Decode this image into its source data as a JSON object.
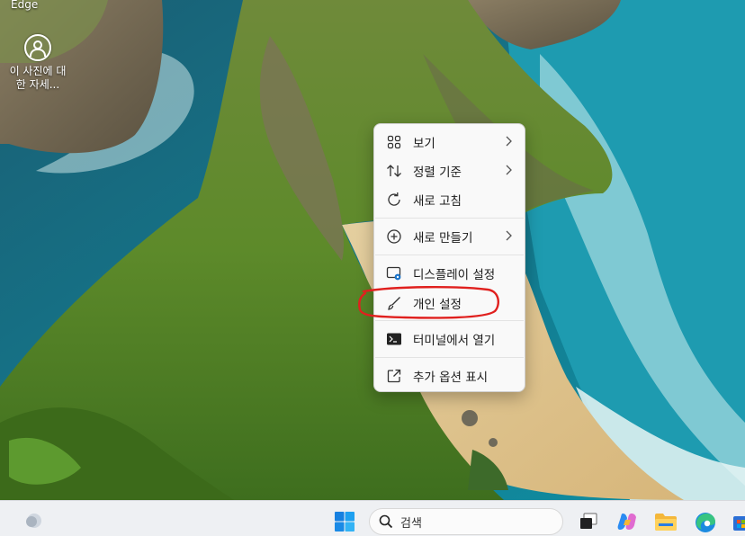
{
  "desktop": {
    "edge_label": "Edge",
    "info_icon_label": "이 사진에 대한 자세..."
  },
  "context_menu": {
    "items": [
      {
        "label": "보기",
        "icon": "grid-icon",
        "has_submenu": true
      },
      {
        "label": "정렬 기준",
        "icon": "sort-icon",
        "has_submenu": true
      },
      {
        "label": "새로 고침",
        "icon": "refresh-icon",
        "has_submenu": false
      },
      {
        "label": "새로 만들기",
        "icon": "add-circle-icon",
        "has_submenu": true
      },
      {
        "label": "디스플레이 설정",
        "icon": "display-icon",
        "has_submenu": false
      },
      {
        "label": "개인 설정",
        "icon": "brush-icon",
        "has_submenu": false
      },
      {
        "label": "터미널에서 열기",
        "icon": "terminal-icon",
        "has_submenu": false
      },
      {
        "label": "추가 옵션 표시",
        "icon": "open-external-icon",
        "has_submenu": false
      }
    ],
    "annotation_color": "#e0201e"
  },
  "taskbar": {
    "search_placeholder": "검색",
    "icons": [
      "weather-icon",
      "windows-start-icon",
      "search-icon",
      "task-view-icon",
      "copilot-icon",
      "file-explorer-icon",
      "edge-icon",
      "store-icon"
    ]
  }
}
